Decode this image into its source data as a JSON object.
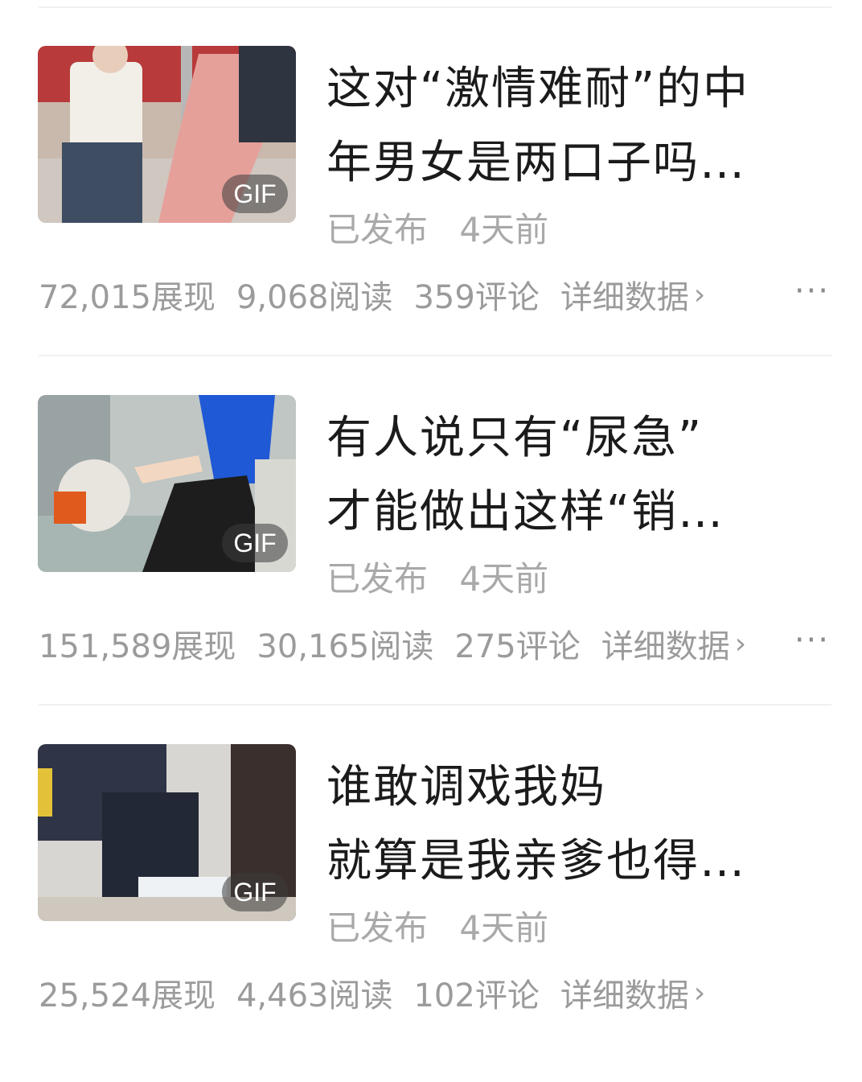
{
  "articles": [
    {
      "title_lines": [
        "这对“激情难耐”的中",
        "年男女是两口子吗…"
      ],
      "badge": "GIF",
      "status": "已发布",
      "time": "4天前",
      "impressions": "72,015展现",
      "reads": "9,068阅读",
      "comments": "359评论",
      "details": "详细数据",
      "more": "···"
    },
    {
      "title_lines": [
        "有人说只有“尿急”",
        "才能做出这样“销…"
      ],
      "badge": "GIF",
      "status": "已发布",
      "time": "4天前",
      "impressions": "151,589展现",
      "reads": "30,165阅读",
      "comments": "275评论",
      "details": "详细数据",
      "more": "···"
    },
    {
      "title_lines": [
        "谁敢调戏我妈",
        "就算是我亲爹也得…"
      ],
      "badge": "GIF",
      "status": "已发布",
      "time": "4天前",
      "impressions": "25,524展现",
      "reads": "4,463阅读",
      "comments": "102评论",
      "details": "详细数据",
      "more": ""
    }
  ]
}
